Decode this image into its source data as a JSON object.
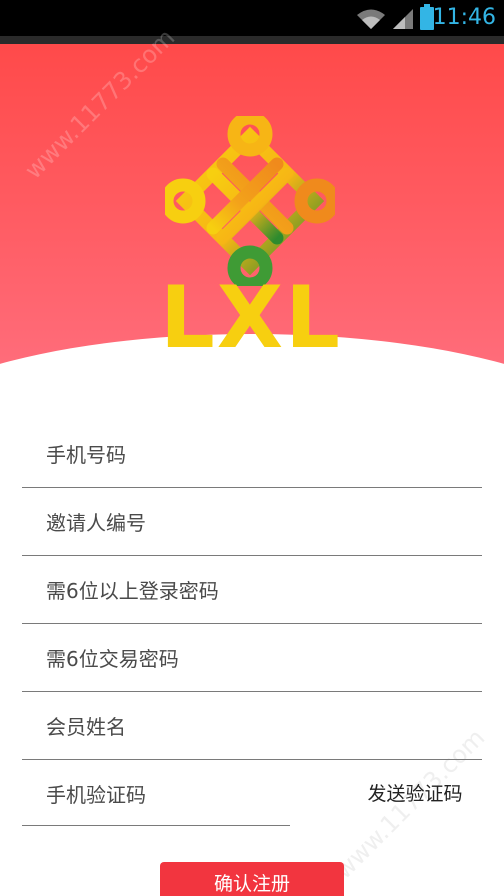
{
  "status_bar": {
    "time": "11:46",
    "icons": [
      "wifi-icon",
      "signal-icon",
      "battery-icon"
    ],
    "accent_color": "#33b5e5"
  },
  "header": {
    "logo_text": "LXL",
    "colors": {
      "background_top": "#ff4a4a",
      "background_bottom": "#ff6f7e",
      "logo_yellow": "#f7cf10",
      "logo_orange": "#f08a1c",
      "logo_green": "#2e8b2e"
    }
  },
  "watermark": {
    "text": "www.11773.com"
  },
  "form": {
    "phone": {
      "placeholder": "手机号码",
      "value": ""
    },
    "inviter_id": {
      "placeholder": "邀请人编号",
      "value": ""
    },
    "login_password": {
      "placeholder": "需6位以上登录密码",
      "value": ""
    },
    "trade_password": {
      "placeholder": "需6位交易密码",
      "value": ""
    },
    "member_name": {
      "placeholder": "会员姓名",
      "value": ""
    },
    "sms_code": {
      "placeholder": "手机验证码",
      "value": ""
    },
    "send_code_label": "发送验证码",
    "submit_label": "确认注册",
    "submit_color": "#f2353f"
  }
}
